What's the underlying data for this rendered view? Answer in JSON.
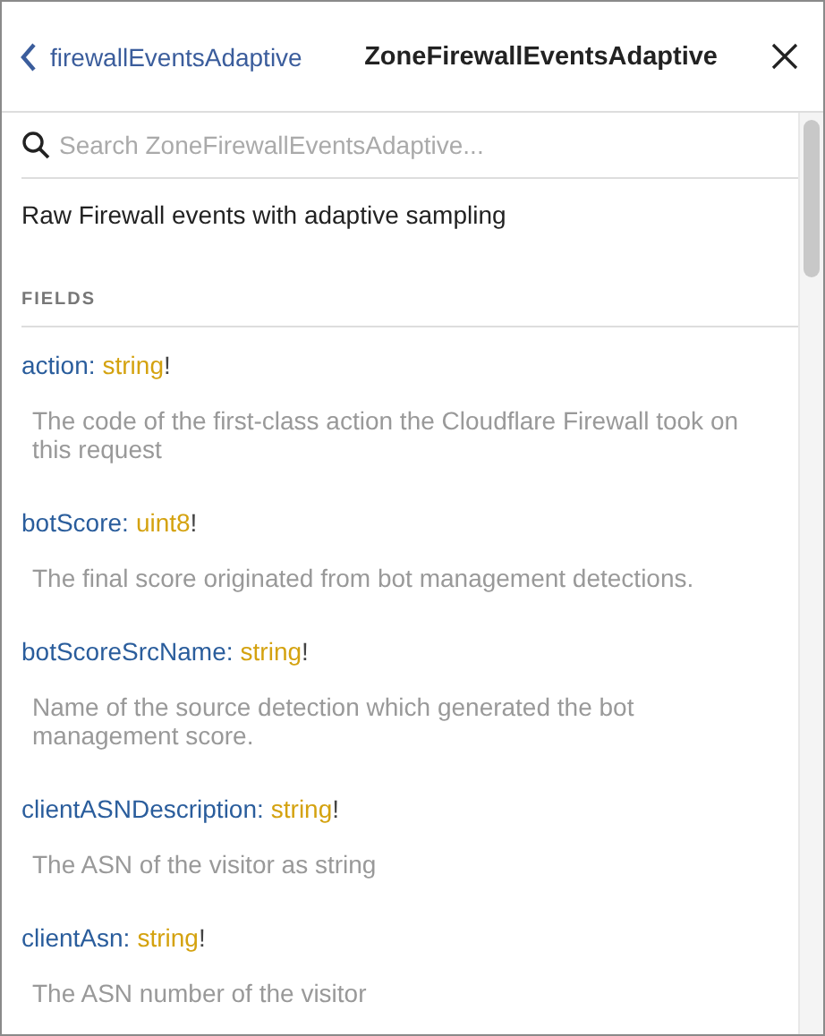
{
  "header": {
    "back": "firewallEventsAdaptive",
    "title": "ZoneFirewallEventsAdaptive"
  },
  "search": {
    "placeholder": "Search ZoneFirewallEventsAdaptive..."
  },
  "description": "Raw Firewall events with adaptive sampling",
  "section": "FIELDS",
  "fields": [
    {
      "name": "action",
      "sep": ":",
      "type": "string",
      "suffix": "!",
      "description": "The code of the first-class action the Cloudflare Firewall took on this request"
    },
    {
      "name": "botScore",
      "sep": ":",
      "type": "uint8",
      "suffix": "!",
      "description": "The final score originated from bot management detections."
    },
    {
      "name": "botScoreSrcName",
      "sep": ":",
      "type": "string",
      "suffix": "!",
      "description": "Name of the source detection which generated the bot management score."
    },
    {
      "name": "clientASNDescription",
      "sep": ":",
      "type": "string",
      "suffix": "!",
      "description": "The ASN of the visitor as string"
    },
    {
      "name": "clientAsn",
      "sep": ":",
      "type": "string",
      "suffix": "!",
      "description": "The ASN number of the visitor"
    }
  ]
}
